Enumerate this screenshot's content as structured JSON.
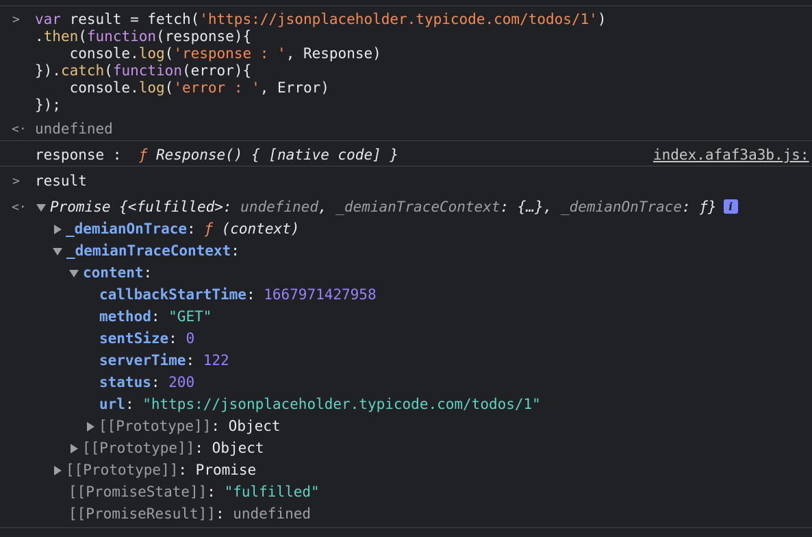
{
  "input1": {
    "l1_kw": "var",
    "l1_rest": " result = fetch(",
    "l1_url": "'https://jsonplaceholder.typicode.com/todos/1'",
    "l1_end": ")",
    "l2_dot": ".",
    "l2_then": "then",
    "l2_paren": "(",
    "l2_kw": "function",
    "l2_args": "(response){",
    "l3_console": "    console.",
    "l3_log": "log",
    "l3_paren": "(",
    "l3_str": "'response : '",
    "l3_rest": ", Response)",
    "l4_a": "}).",
    "l4_catch": "catch",
    "l4_paren": "(",
    "l4_kw": "function",
    "l4_args": "(error){",
    "l5_console": "    console.",
    "l5_log": "log",
    "l5_paren": "(",
    "l5_str": "'error : '",
    "l5_rest": ", Error)",
    "l6": "});"
  },
  "return1": "undefined",
  "log1": {
    "label": "response :  ",
    "f": "ƒ",
    "body": " Response() { [native code] }",
    "source": "index.afaf3a3b.js:"
  },
  "input2": "result",
  "promise": {
    "prefix": "Promise {",
    "fulfilled_key": "<fulfilled>",
    "colon1": ": ",
    "undefined": "undefined",
    "comma1": ", ",
    "trace_ctx_key": "_demianTraceContext",
    "colon2": ": ",
    "trace_ctx_val": "{…}",
    "comma2": ", ",
    "on_trace_key": "_demianOnTrace",
    "colon3": ": ",
    "on_trace_val": "ƒ",
    "close": "}",
    "info": "i"
  },
  "tree": {
    "on_trace_key": "_demianOnTrace",
    "on_trace_colon": ": ",
    "on_trace_f": "ƒ",
    "on_trace_sig": " (context)",
    "trace_ctx_key": "_demianTraceContext",
    "trace_ctx_colon": ":",
    "content_key": "content",
    "content_colon": ":",
    "fields": [
      {
        "key": "callbackStartTime",
        "value": "1667971427958",
        "kind": "num"
      },
      {
        "key": "method",
        "value": "\"GET\"",
        "kind": "str"
      },
      {
        "key": "sentSize",
        "value": "0",
        "kind": "num"
      },
      {
        "key": "serverTime",
        "value": "122",
        "kind": "num"
      },
      {
        "key": "status",
        "value": "200",
        "kind": "num"
      },
      {
        "key": "url",
        "value": "\"https://jsonplaceholder.typicode.com/todos/1\"",
        "kind": "str"
      }
    ],
    "proto_inner_key": "[[Prototype]]",
    "proto_inner_val": "Object",
    "proto_ctx_key": "[[Prototype]]",
    "proto_ctx_val": "Object",
    "proto_promise_key": "[[Prototype]]",
    "proto_promise_val": "Promise",
    "state_key": "[[PromiseState]]",
    "state_val": "\"fulfilled\"",
    "result_key": "[[PromiseResult]]",
    "result_val": "undefined",
    "colon": ": "
  },
  "prompt_input": ">",
  "prompt_return": "<·"
}
